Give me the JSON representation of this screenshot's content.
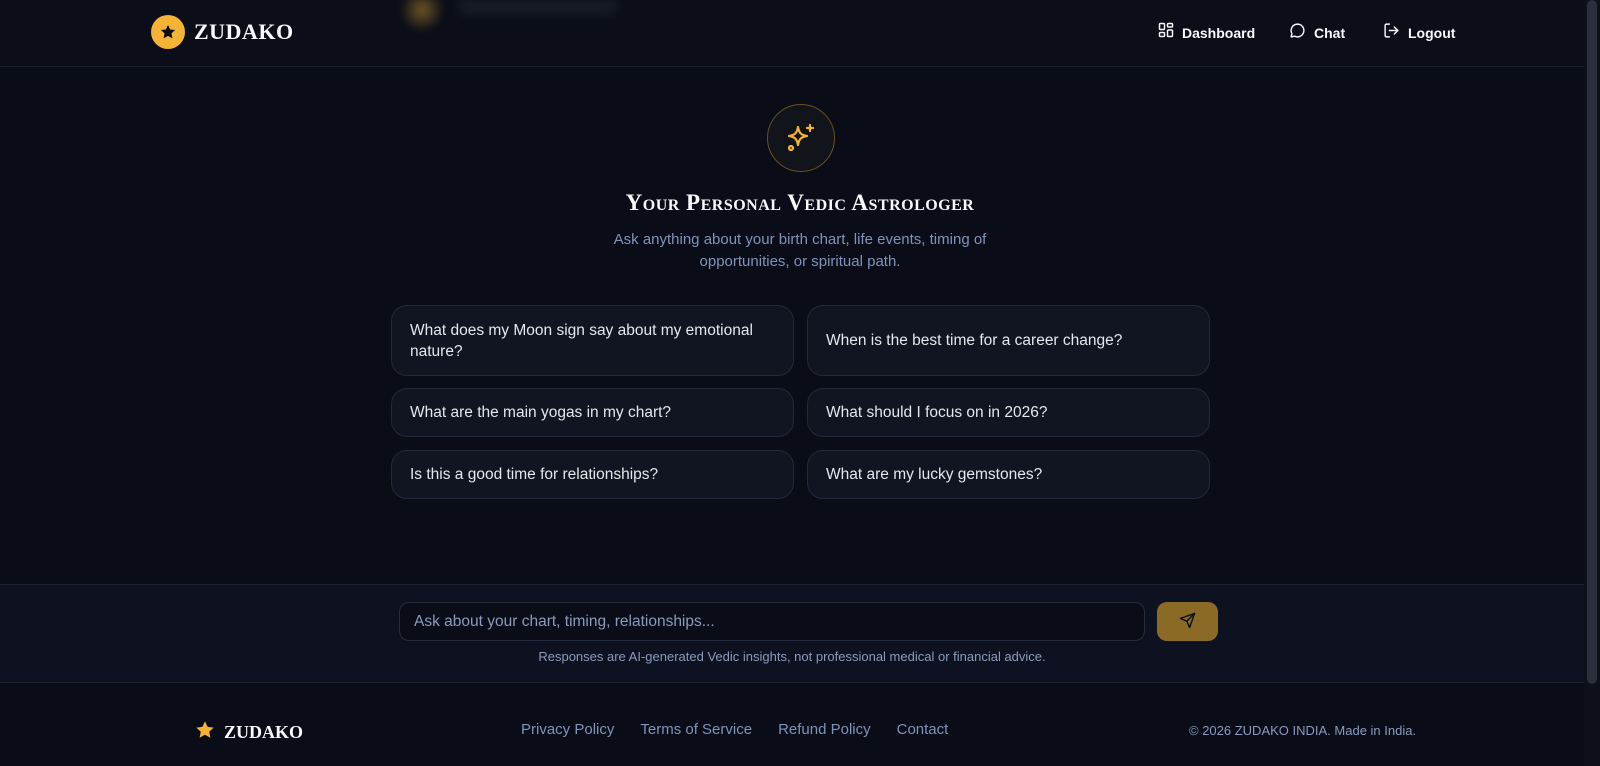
{
  "header": {
    "brand_name": "ZUDAKO",
    "nav": {
      "dashboard": "Dashboard",
      "chat": "Chat",
      "logout": "Logout"
    }
  },
  "hero": {
    "title": "Your Personal Vedic Astrologer",
    "subtitle": "Ask anything about your birth chart, life events, timing of opportunities, or spiritual path."
  },
  "suggestions": [
    "What does my Moon sign say about my emotional nature?",
    "When is the best time for a career change?",
    "What are the main yogas in my chart?",
    "What should I focus on in 2026?",
    "Is this a good time for relationships?",
    "What are my lucky gemstones?"
  ],
  "composer": {
    "placeholder": "Ask about your chart, timing, relationships...",
    "disclaimer": "Responses are AI-generated Vedic insights, not professional medical or financial advice."
  },
  "footer": {
    "brand_name": "ZUDAKO",
    "links": [
      "Privacy Policy",
      "Terms of Service",
      "Refund Policy",
      "Contact"
    ],
    "copyright": "© 2026 ZUDAKO INDIA. Made in India."
  },
  "colors": {
    "accent": "#f5b336",
    "background": "#0a0d17",
    "send_button": "#8a6a25"
  },
  "icons": {
    "brand": "star-icon",
    "dashboard": "dashboard-grid-icon",
    "chat": "chat-bubble-icon",
    "logout": "logout-icon",
    "hero": "sparkles-icon",
    "send": "send-icon"
  }
}
